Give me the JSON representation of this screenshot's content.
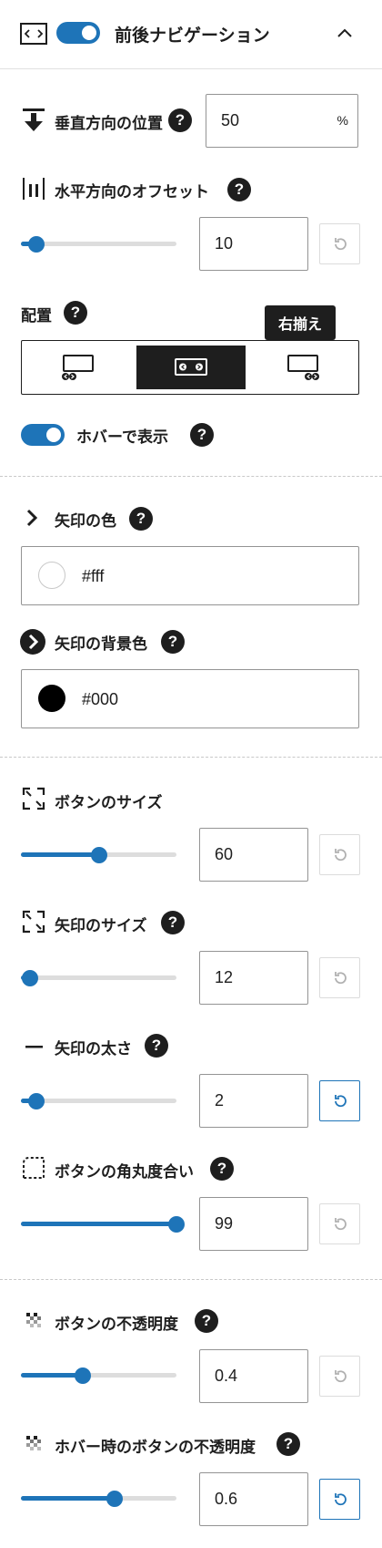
{
  "panel": {
    "title": "前後ナビゲーション",
    "toggle_on": true
  },
  "vertical_position": {
    "label": "垂直方向の位置",
    "value": "50",
    "unit": "%"
  },
  "horizontal_offset": {
    "label": "水平方向のオフセット",
    "value": "10",
    "slider": 0.1
  },
  "alignment": {
    "label": "配置",
    "tooltip": "右揃え",
    "options": [
      "left",
      "center",
      "right"
    ],
    "selected": "center"
  },
  "hover_display": {
    "label": "ホバーで表示",
    "toggle_on": true
  },
  "arrow_color": {
    "label": "矢印の色",
    "value": "#fff",
    "swatch": "#ffffff"
  },
  "arrow_bg_color": {
    "label": "矢印の背景色",
    "value": "#000",
    "swatch": "#000000"
  },
  "button_size": {
    "label": "ボタンのサイズ",
    "value": "60",
    "slider": 0.5
  },
  "arrow_size": {
    "label": "矢印のサイズ",
    "value": "12",
    "slider": 0.06
  },
  "arrow_weight": {
    "label": "矢印の太さ",
    "value": "2",
    "slider": 0.1
  },
  "corner_radius": {
    "label": "ボタンの角丸度合い",
    "value": "99",
    "slider": 1.0
  },
  "button_opacity": {
    "label": "ボタンの不透明度",
    "value": "0.4",
    "slider": 0.4
  },
  "hover_button_opacity": {
    "label": "ホバー時のボタンの不透明度",
    "value": "0.6",
    "slider": 0.6
  },
  "help_glyph": "?",
  "colors": {
    "accent": "#1e74b8",
    "dark": "#1e1e1e"
  }
}
